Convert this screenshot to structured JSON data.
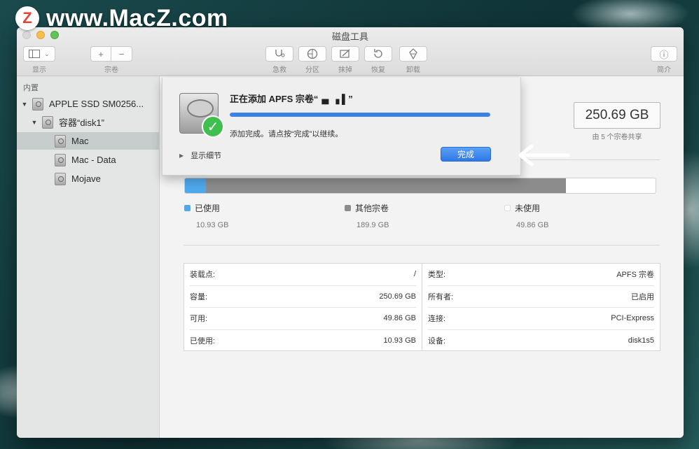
{
  "watermark": {
    "logo": "Z",
    "text": "www.MacZ.com"
  },
  "window": {
    "title": "磁盘工具"
  },
  "toolbar": {
    "view_label": "显示",
    "volume_label": "宗卷",
    "volume_add": "+",
    "volume_remove": "−",
    "first_aid_label": "急救",
    "partition_label": "分区",
    "erase_label": "抹掉",
    "restore_label": "恢复",
    "unmount_label": "卸载",
    "info_label": "简介",
    "info_icon": "ⓘ"
  },
  "sidebar": {
    "section": "内置",
    "items": [
      {
        "label": "APPLE SSD SM0256..."
      },
      {
        "label": "容器“disk1”"
      },
      {
        "label": "Mac"
      },
      {
        "label": "Mac - Data"
      },
      {
        "label": "Mojave"
      }
    ]
  },
  "sheet": {
    "title": "正在添加 APFS 宗卷“▗▖▗ ▌”",
    "message": "添加完成。请点按“完成”以继续。",
    "details": "显示细节",
    "done_button": "完成",
    "progress": 1.0
  },
  "volume": {
    "capacity": "250.69 GB",
    "capacity_sub": "由 5 个宗卷共享"
  },
  "usage": {
    "used_fraction": 0.045,
    "other_fraction": 0.765,
    "colors": {
      "used": "#4fa7ec",
      "other": "#8c8c8c",
      "free": "#ffffff"
    },
    "legend": [
      {
        "label": "已使用",
        "value": "10.93 GB"
      },
      {
        "label": "其他宗卷",
        "value": "189.9 GB"
      },
      {
        "label": "未使用",
        "value": "49.86 GB"
      }
    ]
  },
  "info": {
    "left": [
      {
        "key": "装载点:",
        "value": "/"
      },
      {
        "key": "容量:",
        "value": "250.69 GB"
      },
      {
        "key": "可用:",
        "value": "49.86 GB"
      },
      {
        "key": "已使用:",
        "value": "10.93 GB"
      }
    ],
    "right": [
      {
        "key": "类型:",
        "value": "APFS 宗卷"
      },
      {
        "key": "所有者:",
        "value": "已启用"
      },
      {
        "key": "连接:",
        "value": "PCI-Express"
      },
      {
        "key": "设备:",
        "value": "disk1s5"
      }
    ]
  }
}
